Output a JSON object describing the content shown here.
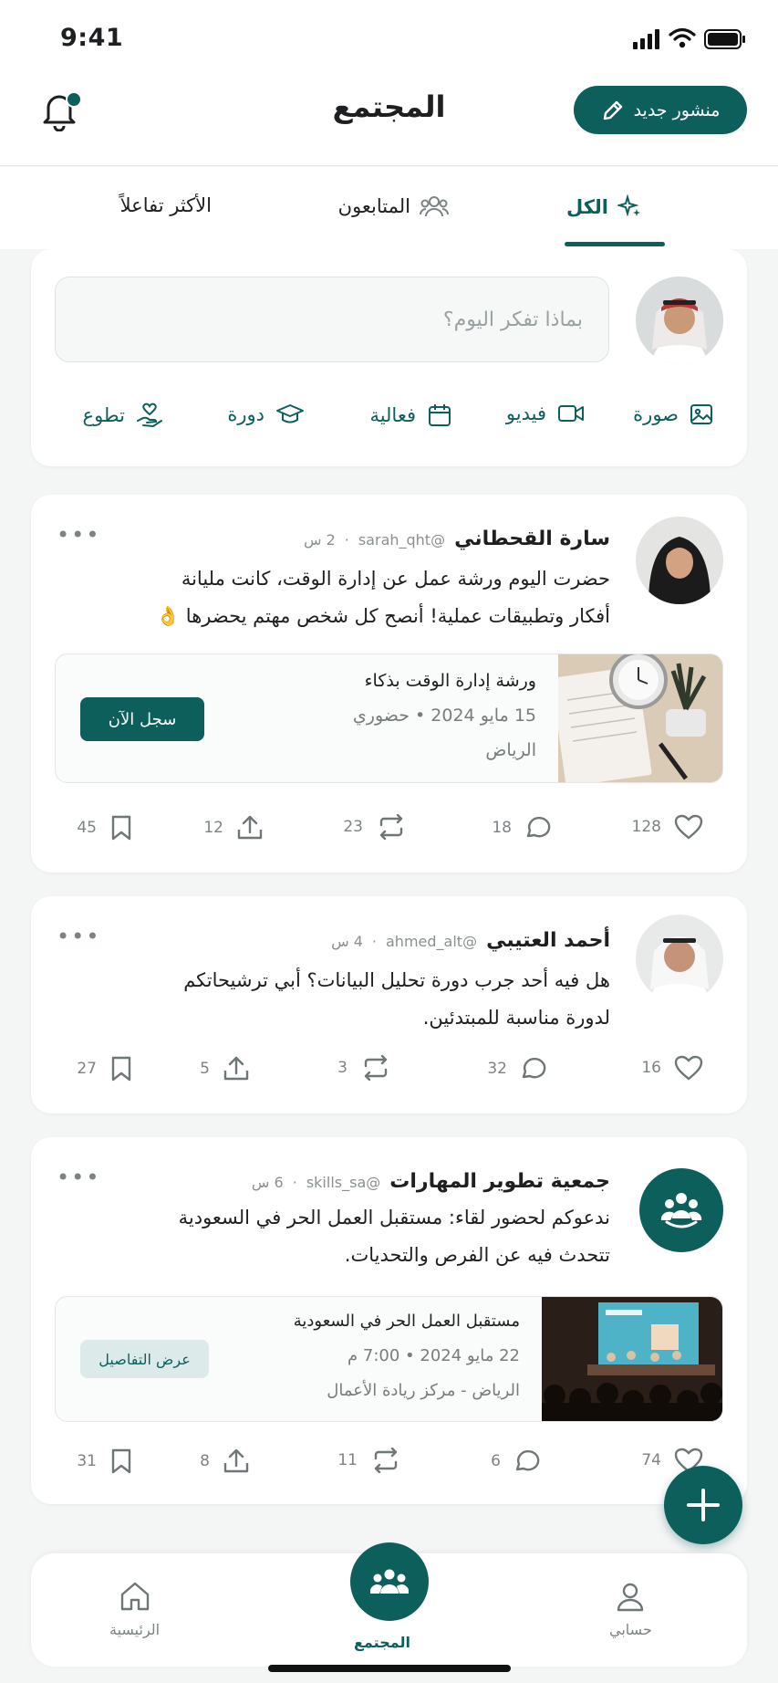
{
  "status_bar": {
    "time": "9:41"
  },
  "header": {
    "title": "المجتمع",
    "new_post_label": "منشور جديد"
  },
  "tabs": [
    {
      "label": "الكل",
      "icon": "sparkle-icon",
      "active": true
    },
    {
      "label": "المتابعون",
      "icon": "people-icon",
      "active": false
    },
    {
      "label": "الأكثر تفاعلاً",
      "icon": "",
      "active": false
    }
  ],
  "composer": {
    "placeholder": "بماذا تفكر اليوم؟",
    "actions": [
      {
        "label": "صورة",
        "icon": "image-icon"
      },
      {
        "label": "فيديو",
        "icon": "video-icon"
      },
      {
        "label": "فعالية",
        "icon": "calendar-icon"
      },
      {
        "label": "دورة",
        "icon": "graduation-cap-icon"
      },
      {
        "label": "تطوع",
        "icon": "volunteer-hand-heart-icon"
      }
    ]
  },
  "posts": [
    {
      "author": "سارة القحطاني",
      "handle": "@sarah_qht",
      "time": "2 س",
      "text_lines": [
        "حضرت اليوم ورشة عمل عن إدارة الوقت، كانت مليانة",
        "أفكار وتطبيقات عملية! أنصح كل شخص مهتم يحضرها 👌"
      ],
      "event": {
        "title": "ورشة إدارة الوقت بذكاء",
        "date": "15 مايو 2024 • حضوري",
        "location": "الرياض",
        "button": "سجل الآن"
      },
      "stats": {
        "likes": "128",
        "comments": "18",
        "reposts": "23",
        "shares": "12",
        "saves": "45"
      }
    },
    {
      "author": "أحمد العتيبي",
      "handle": "@ahmed_alt",
      "time": "4 س",
      "text_lines": [
        "هل فيه أحد جرب دورة تحليل البيانات؟ أبي ترشيحاتكم",
        "لدورة مناسبة للمبتدئين."
      ],
      "stats": {
        "likes": "16",
        "comments": "32",
        "reposts": "3",
        "shares": "5",
        "saves": "27"
      }
    },
    {
      "author": "جمعية تطوير المهارات",
      "handle": "@skills_sa",
      "time": "6 س",
      "text_lines": [
        "ندعوكم لحضور لقاء: مستقبل العمل الحر في السعودية",
        "تتحدث فيه عن الفرص والتحديات."
      ],
      "event": {
        "title": "مستقبل العمل الحر في السعودية",
        "date": "22 مايو 2024 • 7:00 م",
        "location": "الرياض - مركز ريادة الأعمال",
        "button": "عرض التفاصيل"
      },
      "stats": {
        "likes": "74",
        "comments": "6",
        "reposts": "11",
        "shares": "8",
        "saves": "31"
      }
    }
  ],
  "bottom_nav": [
    {
      "label": "الرئيسية",
      "icon": "home-icon"
    },
    {
      "label": "المجتمع",
      "icon": "community-icon",
      "active": true
    },
    {
      "label": "حسابي",
      "icon": "user-icon"
    }
  ],
  "colors": {
    "accent": "#0d5f5c",
    "accent_soft": "#dceaea",
    "background": "#f4f5f5"
  }
}
